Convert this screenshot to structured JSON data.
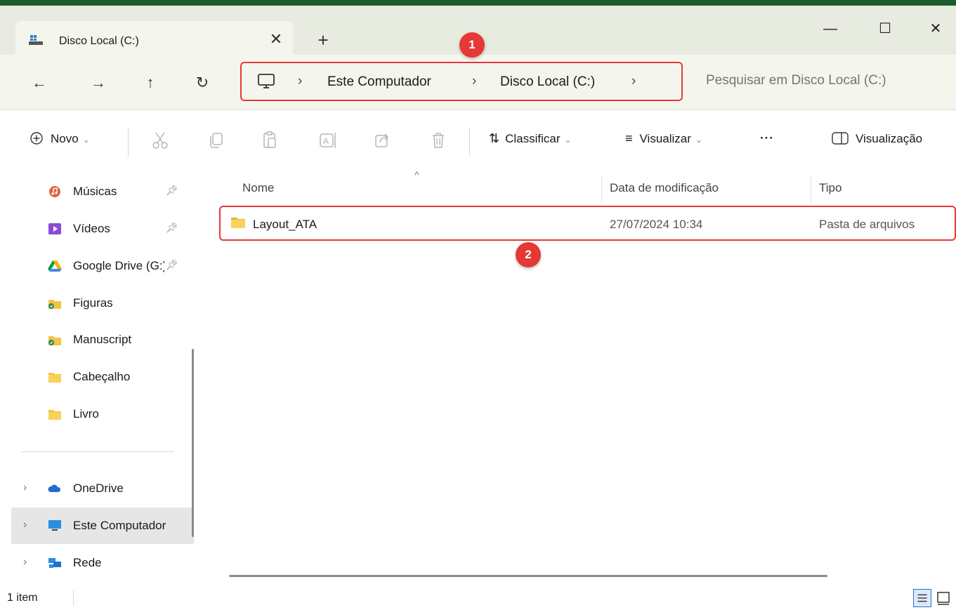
{
  "tab": {
    "title": "Disco Local (C:)",
    "close": "✕",
    "new_tab": "+"
  },
  "window_controls": {
    "minimize": "—",
    "maximize": "☐",
    "close": "✕"
  },
  "nav": {
    "back": "←",
    "forward": "→",
    "up": "↑",
    "refresh": "↻"
  },
  "breadcrumb": {
    "items": [
      "Este Computador",
      "Disco Local (C:)"
    ],
    "separator": "›"
  },
  "search": {
    "placeholder": "Pesquisar em Disco Local (C:)"
  },
  "toolbar": {
    "new_label": "Novo",
    "sort_label": "Classificar",
    "view_label": "Visualizar",
    "more": "···",
    "preview_label": "Visualização"
  },
  "sidebar": {
    "quick_access": [
      {
        "label": "Músicas",
        "icon": "music-icon",
        "pinned": true
      },
      {
        "label": "Vídeos",
        "icon": "video-icon",
        "pinned": true
      },
      {
        "label": "Google Drive (G:)",
        "icon": "google-drive-icon",
        "pinned": true
      },
      {
        "label": "Figuras",
        "icon": "folder-sync-icon",
        "pinned": false
      },
      {
        "label": "Manuscript",
        "icon": "folder-sync-icon",
        "pinned": false
      },
      {
        "label": "Cabeçalho",
        "icon": "folder-icon",
        "pinned": false
      },
      {
        "label": "Livro",
        "icon": "folder-icon",
        "pinned": false
      }
    ],
    "roots": [
      {
        "label": "OneDrive",
        "icon": "cloud-icon"
      },
      {
        "label": "Este Computador",
        "icon": "computer-icon",
        "selected": true
      },
      {
        "label": "Rede",
        "icon": "network-icon"
      }
    ]
  },
  "columns": {
    "name": "Nome",
    "modified": "Data de modificação",
    "type": "Tipo"
  },
  "files": [
    {
      "name": "Layout_ATA",
      "modified": "27/07/2024 10:34",
      "type": "Pasta de arquivos"
    }
  ],
  "annotations": {
    "badge1": "1",
    "badge2": "2"
  },
  "status": {
    "count": "1 item"
  },
  "colors": {
    "highlight": "#e53935",
    "folder": "#f4c542",
    "accent": "#1d5b2c"
  }
}
